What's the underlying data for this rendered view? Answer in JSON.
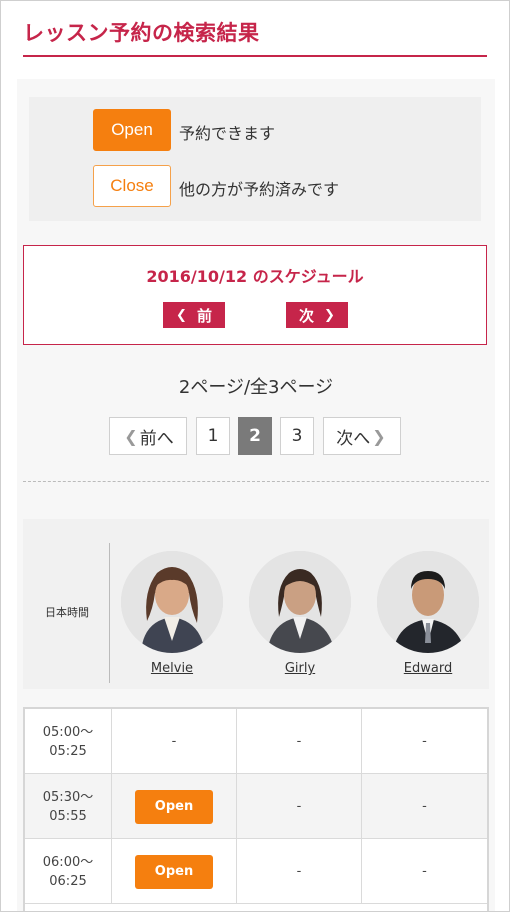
{
  "page": {
    "title": "レッスン予約の検索結果"
  },
  "legend": {
    "open_label": "Open",
    "open_desc": "予約できます",
    "close_label": "Close",
    "close_desc": "他の方が予約済みです"
  },
  "schedule": {
    "title": "2016/10/12 のスケジュール",
    "prev_label": "前",
    "next_label": "次"
  },
  "pagination": {
    "info": "2ページ/全3ページ",
    "prev_label": "前へ",
    "next_label": "次へ",
    "pages": [
      "1",
      "2",
      "3"
    ],
    "current_page": "2"
  },
  "teachers": {
    "time_header": "日本時間",
    "list": [
      {
        "name": "Melvie"
      },
      {
        "name": "Girly"
      },
      {
        "name": "Edward"
      }
    ]
  },
  "slots": [
    {
      "start": "05:00〜",
      "end": "05:25",
      "cells": [
        "-",
        "-",
        "-"
      ]
    },
    {
      "start": "05:30〜",
      "end": "05:55",
      "cells": [
        "Open",
        "-",
        "-"
      ]
    },
    {
      "start": "06:00〜",
      "end": "06:25",
      "cells": [
        "Open",
        "-",
        "-"
      ]
    }
  ],
  "colors": {
    "accent": "#c6254a",
    "open": "#f57f0f",
    "current_page": "#7a7a7a"
  },
  "icons": {
    "chevron_left": "chevron-left-icon",
    "chevron_right": "chevron-right-icon"
  }
}
